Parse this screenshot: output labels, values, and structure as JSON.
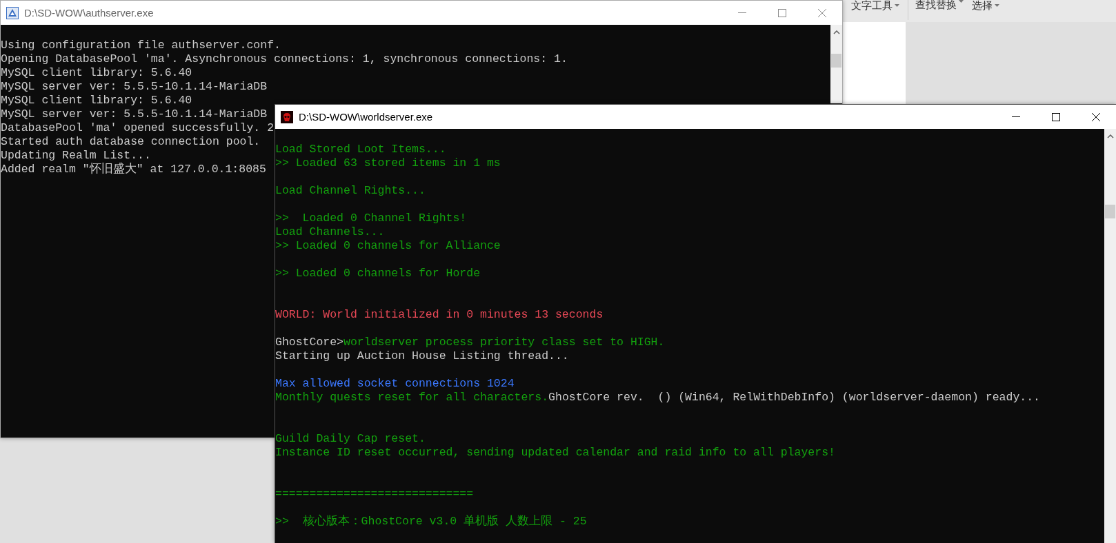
{
  "background_app": {
    "ribbon": [
      {
        "label": "文字工具"
      },
      {
        "label": "查找替换"
      },
      {
        "label": "选择"
      }
    ]
  },
  "auth_window": {
    "title": "D:\\SD-WOW\\authserver.exe",
    "active": false,
    "lines": [
      {
        "kind": "blank"
      },
      {
        "kind": "text",
        "segments": [
          {
            "text": "Using configuration file authserver.conf.",
            "color": "#cccccc"
          }
        ]
      },
      {
        "kind": "text",
        "segments": [
          {
            "text": "Opening DatabasePool 'ma'. Asynchronous connections: 1, synchronous connections: 1.",
            "color": "#cccccc"
          }
        ]
      },
      {
        "kind": "text",
        "segments": [
          {
            "text": "MySQL client library: 5.6.40",
            "color": "#cccccc"
          }
        ]
      },
      {
        "kind": "text",
        "segments": [
          {
            "text": "MySQL server ver: 5.5.5-10.1.14-MariaDB",
            "color": "#cccccc"
          }
        ]
      },
      {
        "kind": "text",
        "segments": [
          {
            "text": "MySQL client library: 5.6.40",
            "color": "#cccccc"
          }
        ]
      },
      {
        "kind": "text",
        "segments": [
          {
            "text": "MySQL server ver: 5.5.5-10.1.14-MariaDB",
            "color": "#cccccc"
          }
        ]
      },
      {
        "kind": "text",
        "segments": [
          {
            "text": "DatabasePool 'ma' opened successfully. 2",
            "color": "#cccccc"
          }
        ]
      },
      {
        "kind": "text",
        "segments": [
          {
            "text": "Started auth database connection pool.",
            "color": "#cccccc"
          }
        ]
      },
      {
        "kind": "text",
        "segments": [
          {
            "text": "Updating Realm List...",
            "color": "#cccccc"
          }
        ]
      },
      {
        "kind": "text",
        "segments": [
          {
            "text": "Added realm \"怀旧盛大\" at 127.0.0.1:8085",
            "color": "#cccccc"
          }
        ]
      }
    ]
  },
  "world_window": {
    "title": "D:\\SD-WOW\\worldserver.exe",
    "active": true,
    "lines": [
      {
        "kind": "blank"
      },
      {
        "kind": "text",
        "segments": [
          {
            "text": "Load Stored Loot Items...",
            "color": "#13a10e"
          }
        ]
      },
      {
        "kind": "text",
        "segments": [
          {
            "text": ">> Loaded 63 stored items in 1 ms",
            "color": "#13a10e"
          }
        ]
      },
      {
        "kind": "blank"
      },
      {
        "kind": "text",
        "segments": [
          {
            "text": "Load Channel Rights...",
            "color": "#13a10e"
          }
        ]
      },
      {
        "kind": "blank"
      },
      {
        "kind": "text",
        "segments": [
          {
            "text": ">>  Loaded 0 Channel Rights!",
            "color": "#13a10e"
          }
        ]
      },
      {
        "kind": "text",
        "segments": [
          {
            "text": "Load Channels...",
            "color": "#13a10e"
          }
        ]
      },
      {
        "kind": "text",
        "segments": [
          {
            "text": ">> Loaded 0 channels for Alliance",
            "color": "#13a10e"
          }
        ]
      },
      {
        "kind": "blank"
      },
      {
        "kind": "text",
        "segments": [
          {
            "text": ">> Loaded 0 channels for Horde",
            "color": "#13a10e"
          }
        ]
      },
      {
        "kind": "blank"
      },
      {
        "kind": "blank"
      },
      {
        "kind": "text",
        "segments": [
          {
            "text": "WORLD: World initialized in 0 minutes 13 seconds",
            "color": "#e74856"
          }
        ]
      },
      {
        "kind": "blank"
      },
      {
        "kind": "text",
        "segments": [
          {
            "text": "GhostCore>",
            "color": "#cccccc"
          },
          {
            "text": "worldserver process priority class set to HIGH.",
            "color": "#13a10e"
          }
        ]
      },
      {
        "kind": "text",
        "segments": [
          {
            "text": "Starting up Auction House Listing thread...",
            "color": "#cccccc"
          }
        ]
      },
      {
        "kind": "blank"
      },
      {
        "kind": "text",
        "segments": [
          {
            "text": "Max allowed socket connections 1024",
            "color": "#3b78ff"
          }
        ]
      },
      {
        "kind": "text",
        "segments": [
          {
            "text": "Monthly quests reset for all characters.",
            "color": "#13a10e"
          },
          {
            "text": "GhostCore rev.  () (Win64, RelWithDebInfo) (worldserver-daemon) ready...",
            "color": "#cccccc"
          }
        ]
      },
      {
        "kind": "blank"
      },
      {
        "kind": "blank"
      },
      {
        "kind": "text",
        "segments": [
          {
            "text": "Guild Daily Cap reset.",
            "color": "#13a10e"
          }
        ]
      },
      {
        "kind": "text",
        "segments": [
          {
            "text": "Instance ID reset occurred, sending updated calendar and raid info to all players!",
            "color": "#13a10e"
          }
        ]
      },
      {
        "kind": "blank"
      },
      {
        "kind": "blank"
      },
      {
        "kind": "text",
        "segments": [
          {
            "text": "=============================",
            "color": "#13a10e"
          }
        ]
      },
      {
        "kind": "blank"
      },
      {
        "kind": "text",
        "segments": [
          {
            "text": ">>  核心版本：GhostCore v3.0 单机版 人数上限 - 25",
            "color": "#13a10e"
          }
        ]
      }
    ]
  }
}
